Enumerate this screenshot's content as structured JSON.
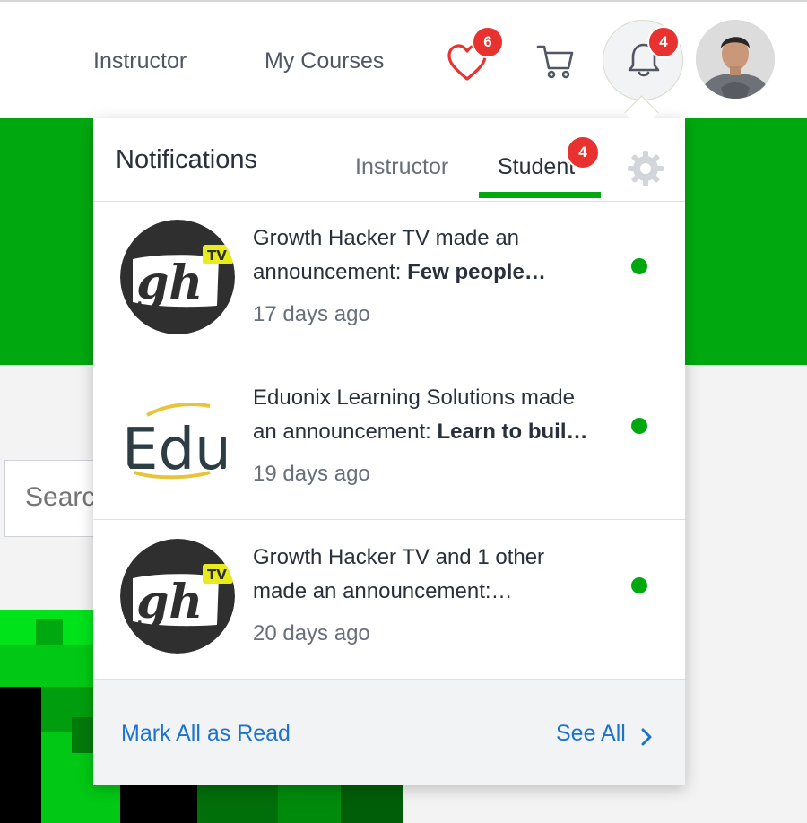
{
  "header": {
    "nav": [
      {
        "label": "Instructor"
      },
      {
        "label": "My Courses"
      }
    ],
    "wishlist_count": "6",
    "notification_count": "4"
  },
  "search": {
    "placeholder": "Search"
  },
  "notifications": {
    "title": "Notifications",
    "tabs": [
      {
        "label": "Instructor",
        "active": false
      },
      {
        "label": "Student",
        "active": true,
        "badge": "4"
      }
    ],
    "items": [
      {
        "avatar": "gh-tv-logo",
        "text_line1": "Growth Hacker TV made an",
        "text_line2_prefix": "announcement: ",
        "text_line2_bold": "Few people…",
        "time": "17 days ago",
        "unread": true
      },
      {
        "avatar": "eduonix-logo",
        "text_line1": "Eduonix Learning Solutions made",
        "text_line2_prefix": "an announcement: ",
        "text_line2_bold": "Learn to buil…",
        "time": "19 days ago",
        "unread": true
      },
      {
        "avatar": "gh-tv-logo",
        "text_line1": "Growth Hacker TV and 1 other",
        "text_line2_prefix": "made an announcement:…",
        "text_line2_bold": "",
        "time": "20 days ago",
        "unread": true
      }
    ],
    "footer": {
      "mark_all_label": "Mark All as Read",
      "see_all_label": "See All"
    }
  },
  "colors": {
    "accent_green": "#00a80f",
    "badge_red": "#e8322f",
    "link_blue": "#1c73cf"
  }
}
